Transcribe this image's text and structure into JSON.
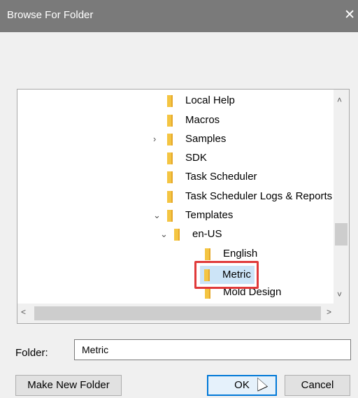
{
  "dialog": {
    "title": "Browse For Folder",
    "close_glyph": "✕"
  },
  "tree": {
    "items": [
      {
        "label": "Local Help",
        "expander": ""
      },
      {
        "label": "Macros",
        "expander": ""
      },
      {
        "label": "Samples",
        "expander": "›"
      },
      {
        "label": "SDK",
        "expander": ""
      },
      {
        "label": "Task Scheduler",
        "expander": ""
      },
      {
        "label": "Task Scheduler Logs & Reports",
        "expander": ""
      },
      {
        "label": "Templates",
        "expander": "⌄"
      },
      {
        "label": "en-US",
        "expander": "⌄"
      },
      {
        "label": "English",
        "expander": ""
      },
      {
        "label": "Metric",
        "expander": "",
        "selected": true
      },
      {
        "label": "Mold Design",
        "expander": ""
      }
    ],
    "scroll_up": "˄",
    "scroll_down": "˅",
    "scroll_left": "<",
    "scroll_right": ">"
  },
  "folder_field": {
    "label": "Folder:",
    "value": "Metric"
  },
  "buttons": {
    "make_new_folder": "Make New Folder",
    "ok": "OK",
    "cancel": "Cancel"
  },
  "colors": {
    "titlebar": "#7a7a7a",
    "folder_icon": "#f4c542",
    "selection": "#cce4f7",
    "highlight_box": "#e03a3a",
    "default_button_border": "#0078d7"
  }
}
